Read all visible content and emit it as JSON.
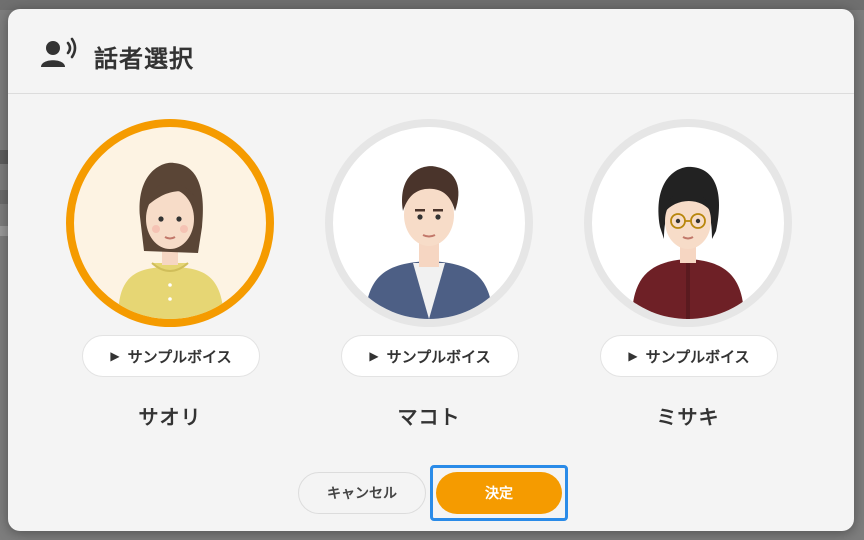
{
  "dialog": {
    "title": "話者選択",
    "header_icon": "speaker-voice-icon"
  },
  "speakers": [
    {
      "name": "サオリ",
      "sample_label": "サンプルボイス",
      "selected": true
    },
    {
      "name": "マコト",
      "sample_label": "サンプルボイス",
      "selected": false
    },
    {
      "name": "ミサキ",
      "sample_label": "サンプルボイス",
      "selected": false
    }
  ],
  "footer": {
    "cancel_label": "キャンセル",
    "ok_label": "決定"
  },
  "colors": {
    "accent": "#f59b00",
    "focus_ring": "#2a8be8",
    "selected_bg": "#fdf3e3"
  }
}
